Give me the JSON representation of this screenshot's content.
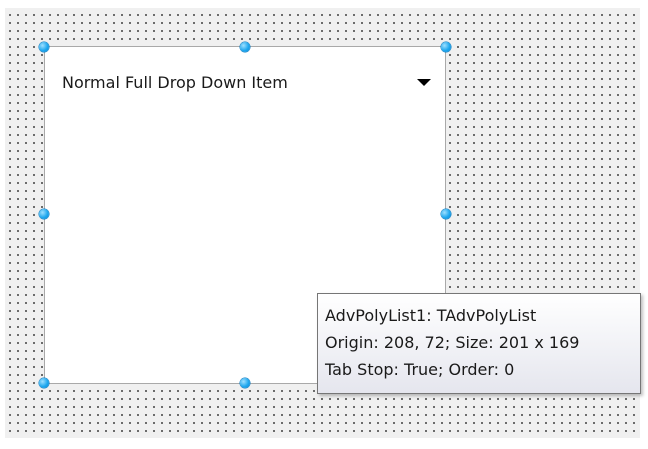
{
  "component": {
    "item_label": "Normal Full Drop Down Item",
    "dropdown_icon": "chevron-down-icon"
  },
  "tooltip": {
    "line1": "AdvPolyList1: TAdvPolyList",
    "line2": "Origin: 208, 72; Size: 201 x 169",
    "line3": "Tab Stop: True; Order: 0"
  },
  "colors": {
    "handle": "#1ea7ee",
    "grid_dot": "#4a4a4a",
    "designer_bg": "#f0f0f0"
  }
}
